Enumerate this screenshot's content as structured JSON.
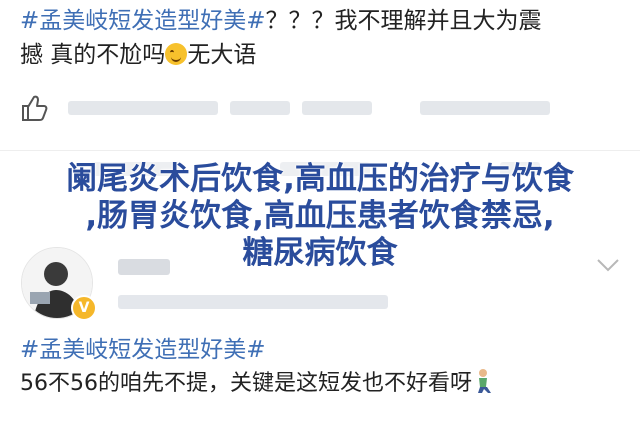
{
  "post1": {
    "hashtag": "#孟美岐短发造型好美#",
    "text_line1": "？？？我不理解并且大为震",
    "text_line2_before_emoji": "撼 真的不尬吗",
    "text_line2_after_emoji": "无大语",
    "emoji": "grimace-face"
  },
  "overlay": {
    "line1": "阑尾炎术后饮食,高血压的治疗与饮食",
    "line2": ",肠胃炎饮食,高血压患者饮食禁忌,",
    "line3": "糖尿病饮食"
  },
  "comment": {
    "verified_badge": "V"
  },
  "post2": {
    "hashtag": "#孟美岐短发造型好美#",
    "text": "56不56的咱先不提，关键是这短发也不好看呀",
    "emoji": "kneeling-person"
  },
  "colors": {
    "hashtag": "#3f6fb5",
    "overlay_text": "#2a4c9c",
    "badge": "#f5b72a"
  }
}
